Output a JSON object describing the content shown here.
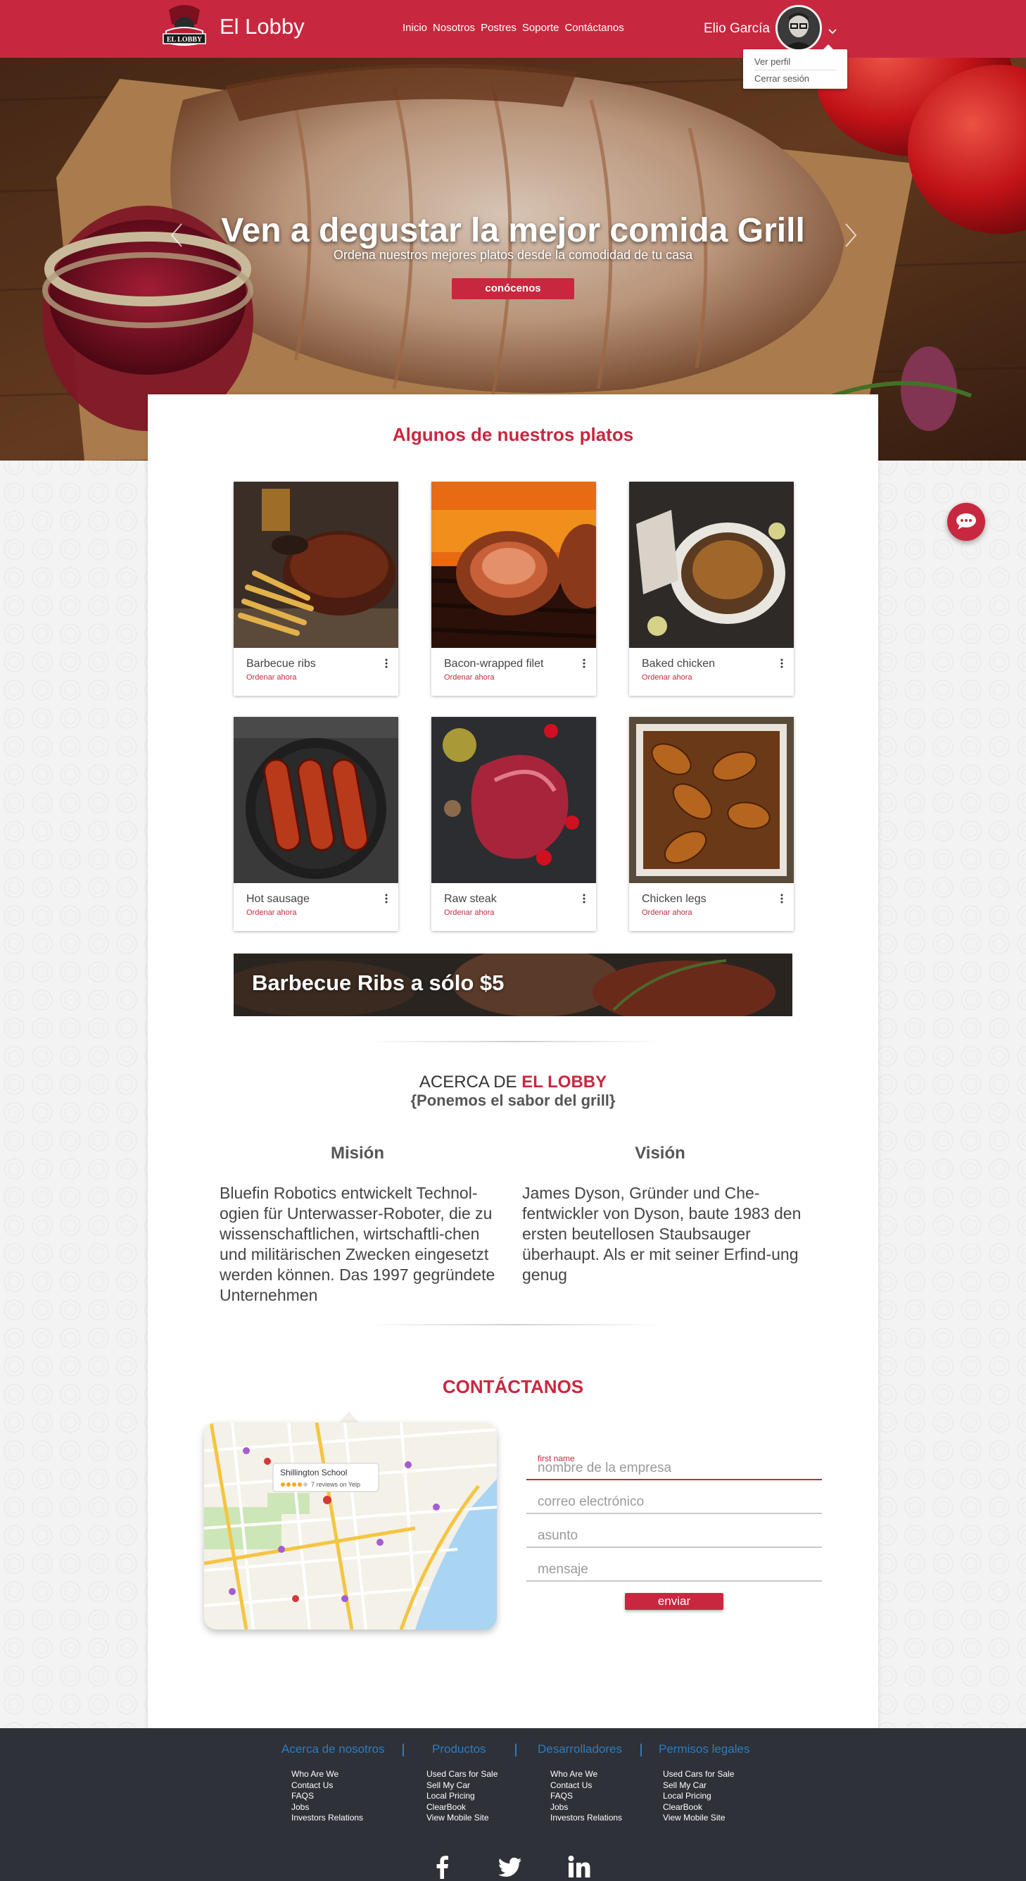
{
  "header": {
    "brand": "El Lobby",
    "logo_text": "EL LOBBY",
    "nav": [
      "Inicio",
      "Nosotros",
      "Postres",
      "Soporte",
      "Contáctanos"
    ],
    "user_name": "Elio García",
    "dropdown": [
      "Ver perfil",
      "Cerrar sesión"
    ]
  },
  "hero": {
    "title": "Ven a degustar la mejor comida Grill",
    "subtitle": "Ordena nuestros mejores platos desde la comodidad de tu casa",
    "cta": "conócenos"
  },
  "dishes": {
    "title": "Algunos de nuestros platos",
    "order_label": "Ordenar ahora",
    "items": [
      {
        "name": "Barbecue ribs"
      },
      {
        "name": "Bacon-wrapped filet"
      },
      {
        "name": "Baked chicken"
      },
      {
        "name": "Hot sausage"
      },
      {
        "name": "Raw steak"
      },
      {
        "name": "Chicken legs"
      }
    ]
  },
  "promo": {
    "text": "Barbecue Ribs a sólo $5"
  },
  "about": {
    "title_prefix": "ACERCA DE ",
    "title_brand": "EL LOBBY",
    "subtitle": "{Ponemos el sabor del grill}",
    "mission_title": "Misión",
    "mission_text": "Bluefin Robotics entwickelt Technol-ogien für Unterwasser-Roboter, die zu wissenschaftlichen, wirtschaftli-chen und militärischen Zwecken eingesetzt werden können. Das 1997 gegründete Unternehmen",
    "vision_title": "Visión",
    "vision_text": "James Dyson, Gründer und Che-fentwickler von Dyson, baute 1983 den ersten beutellosen Staubsauger überhaupt. Als er mit seiner Erfind-ung genug"
  },
  "contact": {
    "title": "CONTÁCTANOS",
    "map_place": "Shillington School",
    "map_reviews": "7 reviews on Yelp",
    "fields": [
      {
        "label": "first name",
        "placeholder": "nombre de la empresa"
      },
      {
        "label": "",
        "placeholder": "correo electrónico"
      },
      {
        "label": "",
        "placeholder": "asunto"
      },
      {
        "label": "",
        "placeholder": "mensaje"
      }
    ],
    "submit": "enviar"
  },
  "footer": {
    "columns": [
      {
        "heading": "Acerca de nosotros",
        "links": [
          "Who Are We",
          "Contact Us",
          "FAQS",
          "Jobs",
          "Investors Relations"
        ]
      },
      {
        "heading": "Productos",
        "links": [
          "Used Cars for Sale",
          "Sell My Car",
          "Local Pricing",
          "ClearBook",
          "View Mobile Site"
        ]
      },
      {
        "heading": "Desarrolladores",
        "links": [
          "Who Are We",
          "Contact Us",
          "FAQS",
          "Jobs",
          "Investors Relations"
        ]
      },
      {
        "heading": "Permisos legales",
        "links": [
          "Used Cars for Sale",
          "Sell My Car",
          "Local Pricing",
          "ClearBook",
          "View Mobile Site"
        ]
      }
    ],
    "social": [
      "facebook-icon",
      "twitter-icon",
      "linkedin-icon"
    ]
  },
  "colors": {
    "brand": "#c8283f",
    "footer": "#2e3137",
    "footer_link": "#2f7bbf"
  }
}
